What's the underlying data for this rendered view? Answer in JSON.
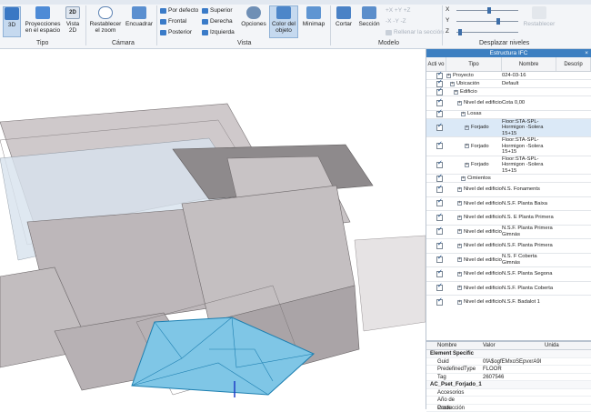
{
  "ribbon": {
    "buttons": {
      "view3d": "3D",
      "proj": "Proyecciones en el espacio",
      "view2d": "Vista 2D",
      "reset_zoom": "Restablecer el zoom",
      "fit": "Encuadrar",
      "options": "Opciones",
      "color": "Color del objeto",
      "minimap": "Minimap",
      "cut": "Cortar",
      "section": "Sección",
      "restore": "Restablecer"
    },
    "views": [
      "Por defecto",
      "Superior",
      "Frontal",
      "Derecha",
      "Posterior",
      "Izquierda"
    ],
    "axes_row1": "+X  +Y  +Z",
    "axes_row2": "-X  -Y  -Z",
    "fill_section": "Rellenar la sección",
    "slider_labels": [
      "X",
      "Y",
      "Z"
    ],
    "groups": [
      "Tipo",
      "Cámara",
      "Vista",
      "Modelo",
      "Desplazar niveles"
    ]
  },
  "panel": {
    "title": "Estructura IFC",
    "columns": [
      "Acti vo",
      "Tipo",
      "Nombre",
      "Descrip"
    ],
    "rows": [
      {
        "indent": 0,
        "tipo": "Proyecto",
        "nombre": "024-03-16"
      },
      {
        "indent": 1,
        "tipo": "Ubicación",
        "nombre": "Default"
      },
      {
        "indent": 2,
        "tipo": "Edificio",
        "nombre": ""
      },
      {
        "indent": 3,
        "tipo": "Nivel del edificio",
        "nombre": "Cota 0,00"
      },
      {
        "indent": 4,
        "tipo": "Losas",
        "nombre": ""
      },
      {
        "indent": 5,
        "tipo": "Forjado",
        "nombre": "Floor:STA-SPL-Hormigon -Solera 15+15",
        "hl": true
      },
      {
        "indent": 5,
        "tipo": "Forjado",
        "nombre": "Floor:STA-SPL-Hormigon -Solera 15+15"
      },
      {
        "indent": 5,
        "tipo": "Forjado",
        "nombre": "Floor:STA-SPL-Hormigon -Solera 15+15"
      },
      {
        "indent": 4,
        "tipo": "Cimientos",
        "nombre": ""
      },
      {
        "indent": 3,
        "tipo": "Nivel del edificio",
        "nombre": "N.S. Fonaments"
      },
      {
        "indent": 3,
        "tipo": "Nivel del edificio",
        "nombre": "N.S.F. Planta Baixa"
      },
      {
        "indent": 3,
        "tipo": "Nivel del edificio",
        "nombre": "N.S. E Planta Primera"
      },
      {
        "indent": 3,
        "tipo": "Nivel del edificio",
        "nombre": "N.S.F. Planta Primera Gimnàs"
      },
      {
        "indent": 3,
        "tipo": "Nivel del edificio",
        "nombre": "N.S.F. Planta Primera"
      },
      {
        "indent": 3,
        "tipo": "Nivel del edificio",
        "nombre": "N.S. F Coberta Gimnàs"
      },
      {
        "indent": 3,
        "tipo": "Nivel del edificio",
        "nombre": "N.S.F. Planta Segona"
      },
      {
        "indent": 3,
        "tipo": "Nivel del edificio",
        "nombre": "N.S.F. Planta Coberta"
      },
      {
        "indent": 3,
        "tipo": "Nivel del edificio",
        "nombre": "N.S.F. Badalot 1"
      }
    ]
  },
  "props": {
    "columns": [
      "Nombre",
      "Valor",
      "Unida"
    ],
    "sections": [
      {
        "title": "Element Specific",
        "items": [
          {
            "k": "Guid",
            "v": "0fA$ogfEMxoSEpvxrA9l"
          },
          {
            "k": "PredefinedType",
            "v": "FLOOR"
          },
          {
            "k": "Tag",
            "v": "2607546"
          }
        ]
      },
      {
        "title": "AC_Pset_Forjado_1",
        "items": [
          {
            "k": "Accesorios",
            "v": ""
          },
          {
            "k": "Año de Producción",
            "v": ""
          },
          {
            "k": "Coste",
            "v": ""
          }
        ]
      }
    ]
  }
}
